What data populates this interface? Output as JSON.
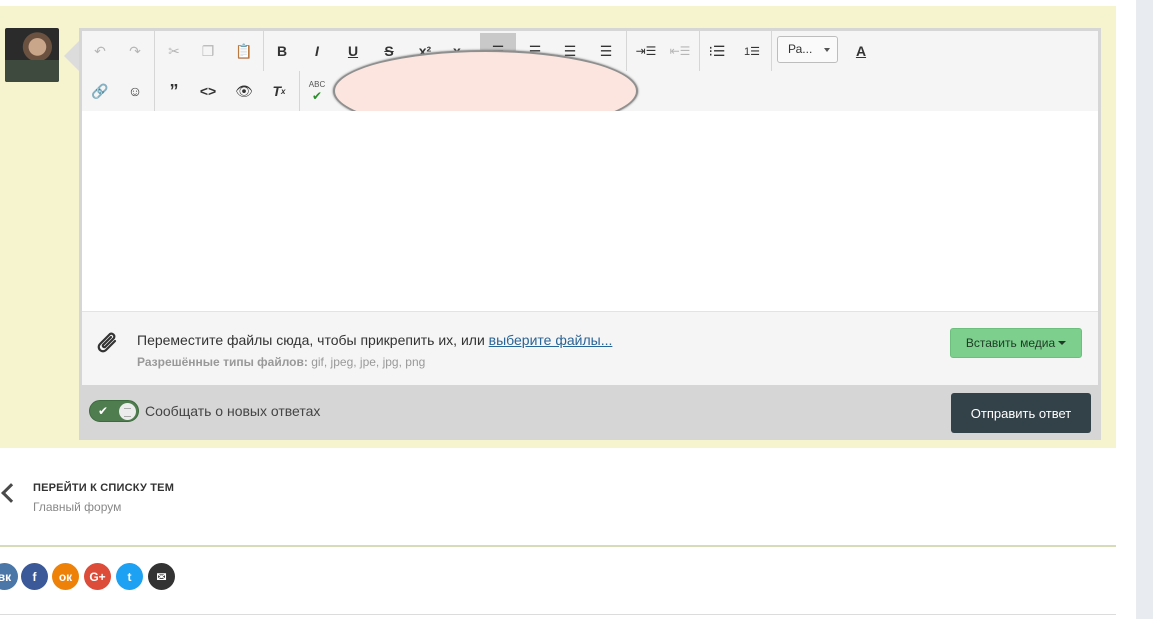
{
  "editor": {
    "toolbar": {
      "font_select": "Ра...",
      "spellcheck_label": "ABC"
    },
    "attach": {
      "drop_text": "Переместите файлы сюда, чтобы прикрепить их, или ",
      "choose_link": "выберите файлы...",
      "allowed_label": "Разрешённые типы файлов:",
      "allowed_types": " gif, jpeg, jpe, jpg, png",
      "insert_media": "Вставить медиа"
    },
    "submit": {
      "notify_label": "Сообщать о новых ответах",
      "send_button": "Отправить ответ"
    }
  },
  "navigation": {
    "back_title": "ПЕРЕЙТИ К СПИСКУ ТЕМ",
    "back_subtitle": "Главный форум"
  },
  "share": [
    {
      "icon": "vk-icon",
      "color": "#4a76a8",
      "glyph": "вк"
    },
    {
      "icon": "facebook-icon",
      "color": "#3b5998",
      "glyph": "f"
    },
    {
      "icon": "odnoklassniki-icon",
      "color": "#ee8208",
      "glyph": "ок"
    },
    {
      "icon": "google-plus-icon",
      "color": "#dd4b39",
      "glyph": "G+"
    },
    {
      "icon": "twitter-icon",
      "color": "#1da1f2",
      "glyph": "t"
    },
    {
      "icon": "email-icon",
      "color": "#333333",
      "glyph": "✉"
    }
  ]
}
